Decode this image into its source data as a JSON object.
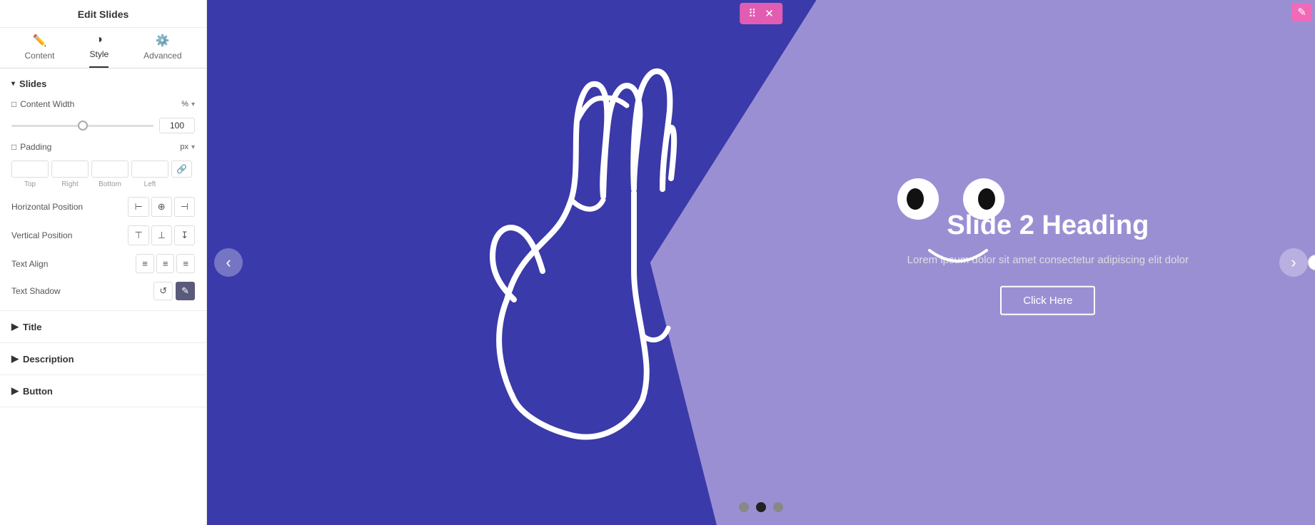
{
  "panel": {
    "title": "Edit Slides",
    "tabs": [
      {
        "id": "content",
        "label": "Content",
        "icon": "✏️",
        "active": false
      },
      {
        "id": "style",
        "label": "Style",
        "icon": "◑",
        "active": true
      },
      {
        "id": "advanced",
        "label": "Advanced",
        "icon": "⚙️",
        "active": false
      }
    ],
    "sections": {
      "slides": {
        "label": "Slides",
        "content_width_label": "Content Width",
        "content_width_icon": "□",
        "content_width_unit": "%",
        "content_width_value": "100",
        "padding_label": "Padding",
        "padding_icon": "□",
        "padding_unit": "px",
        "padding_top": "",
        "padding_right": "",
        "padding_bottom": "",
        "padding_left": "",
        "padding_top_label": "Top",
        "padding_right_label": "Right",
        "padding_bottom_label": "Bottom",
        "padding_left_label": "Left",
        "horizontal_position_label": "Horizontal Position",
        "vertical_position_label": "Vertical Position",
        "text_align_label": "Text Align",
        "text_shadow_label": "Text Shadow"
      },
      "title": {
        "label": "Title"
      },
      "description": {
        "label": "Description"
      },
      "button": {
        "label": "Button"
      }
    }
  },
  "slide": {
    "heading": "Slide 2 Heading",
    "description": "Lorem ipsum dolor sit amet consectetur adipiscing elit dolor",
    "button_label": "Click Here",
    "dots": [
      {
        "index": 0,
        "active": false
      },
      {
        "index": 1,
        "active": true
      },
      {
        "index": 2,
        "active": false
      }
    ]
  },
  "toolbar": {
    "move_icon": "⠿",
    "close_icon": "✕",
    "edit_icon": "✎"
  }
}
